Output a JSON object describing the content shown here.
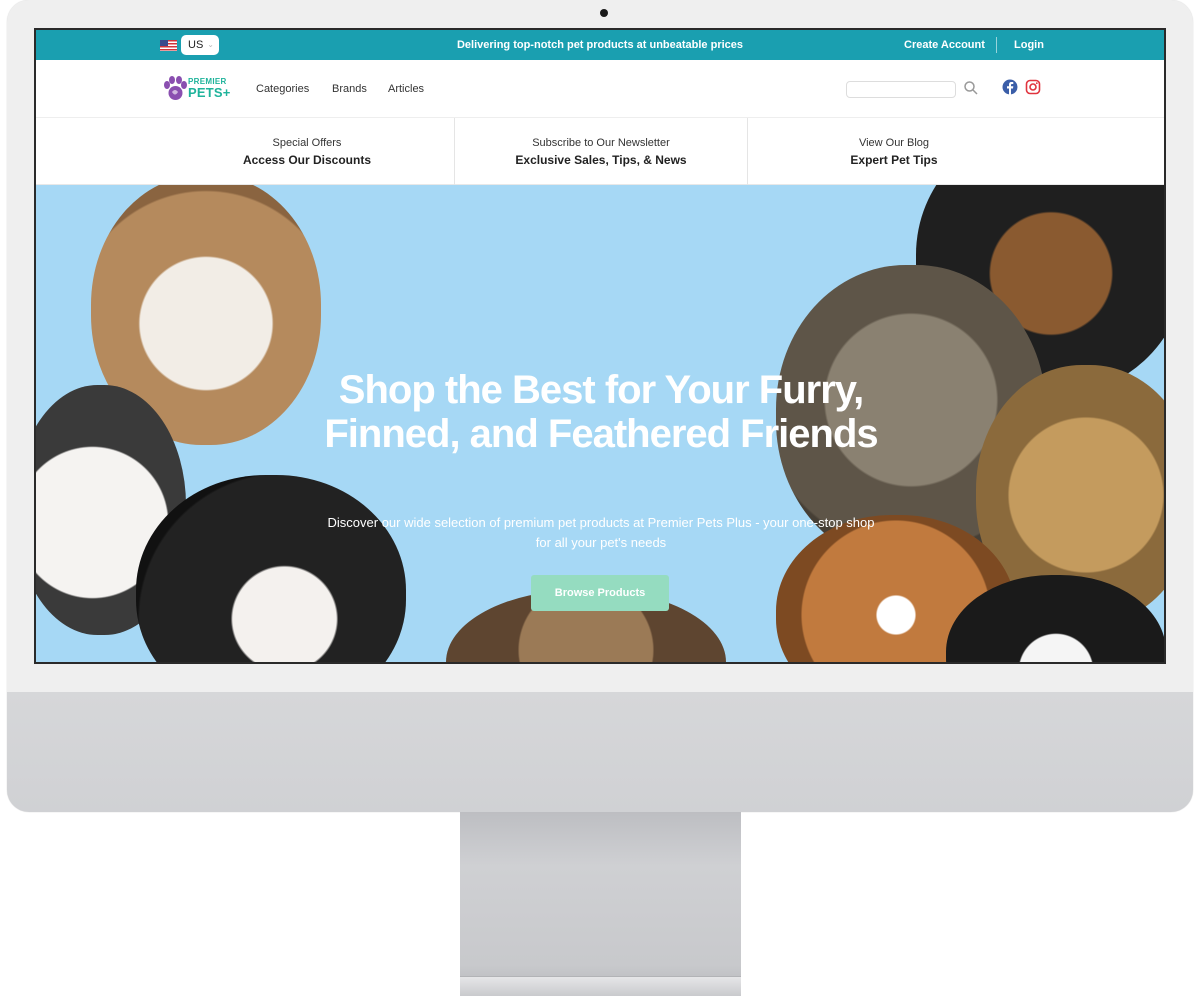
{
  "topbar": {
    "locale": "US",
    "tagline": "Delivering top-notch pet products at unbeatable prices",
    "create_account": "Create Account",
    "login": "Login",
    "color": "#1a9fb0"
  },
  "navbar": {
    "logo_line1": "PREMIER",
    "logo_line2": "PETS+",
    "links": [
      "Categories",
      "Brands",
      "Articles"
    ],
    "search_placeholder": "",
    "icons": [
      "search-icon",
      "facebook-icon",
      "instagram-icon"
    ]
  },
  "promo": [
    {
      "small": "Special Offers",
      "big": "Access Our Discounts"
    },
    {
      "small": "Subscribe to Our Newsletter",
      "big": "Exclusive Sales, Tips, & News"
    },
    {
      "small": "View Our Blog",
      "big": "Expert Pet Tips"
    }
  ],
  "hero": {
    "title": "Shop the Best for Your Furry, Finned, and Feathered Friends",
    "subtitle": "Discover our wide selection of premium pet products at Premier Pets Plus - your one-stop shop for all your pet's needs",
    "button": "Browse Products",
    "background_color": "#a6d8f5",
    "button_color": "#95dcc0"
  }
}
